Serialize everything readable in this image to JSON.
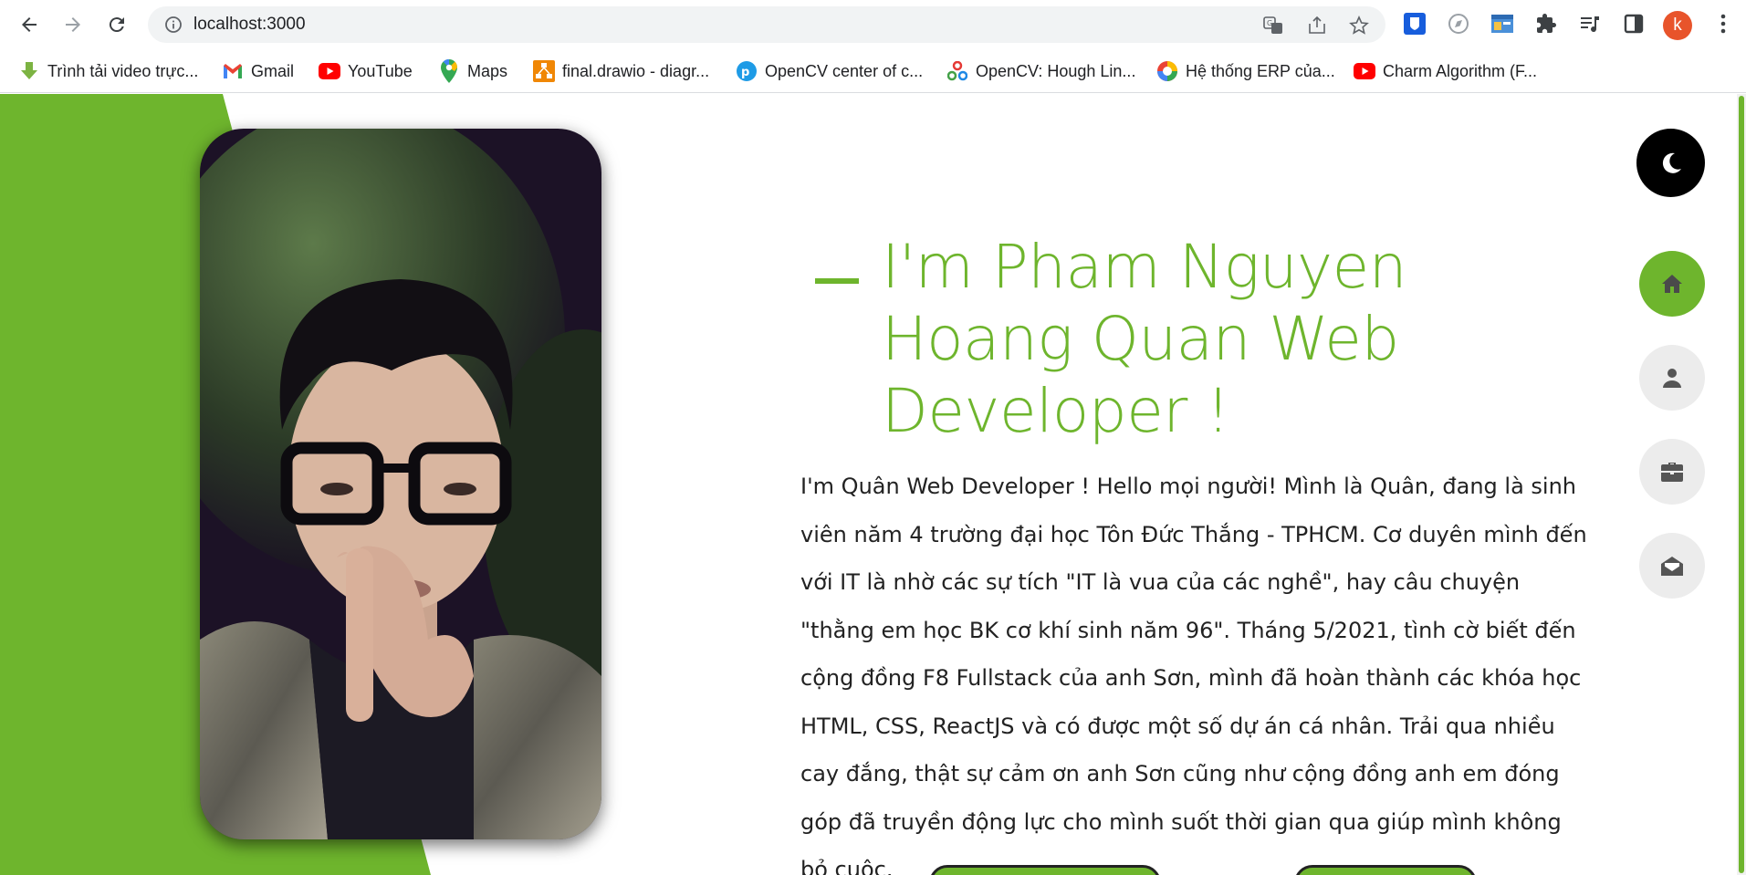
{
  "browser": {
    "url": "localhost:3000",
    "profile_initial": "k",
    "bookmarks": [
      {
        "label": "Trình tải video trực...",
        "icon": "download-arrow-icon",
        "color": "#7cb342"
      },
      {
        "label": "Gmail",
        "icon": "gmail-icon",
        "color": "#ea4335"
      },
      {
        "label": "YouTube",
        "icon": "youtube-icon",
        "color": "#ff0000"
      },
      {
        "label": "Maps",
        "icon": "maps-pin-icon",
        "color": "#34a853"
      },
      {
        "label": "final.drawio - diagr...",
        "icon": "drawio-icon",
        "color": "#f08705"
      },
      {
        "label": "OpenCV center of c...",
        "icon": "pyimagesearch-icon",
        "color": "#1e9be6"
      },
      {
        "label": "OpenCV: Hough Lin...",
        "icon": "opencv-icon",
        "color": "#5c6bc0"
      },
      {
        "label": "Hệ thống ERP của...",
        "icon": "erp-icon",
        "color": "#4285f4"
      },
      {
        "label": "Charm Algorithm (F...",
        "icon": "youtube-icon",
        "color": "#ff0000"
      }
    ]
  },
  "hero": {
    "headline": "I'm Pham Nguyen Hoang Quan Web Developer !",
    "bio": "I'm Quân Web Developer ! Hello mọi người! Mình là Quân, đang là sinh viên năm 4 trường đại học Tôn Đức Thắng - TPHCM. Cơ duyên mình đến với IT là nhờ các sự tích \"IT là vua của các nghề\", hay câu chuyện \"thằng em học BK cơ khí sinh năm 96\". Tháng 5/2021, tình cờ biết đến cộng đồng F8 Fullstack của anh Sơn, mình đã hoàn thành các khóa học HTML, CSS, ReactJS và có được một số dự án cá nhân. Trải qua nhiều cay đắng, thật sự cảm ơn anh Sơn cũng như cộng đồng anh em đóng góp đã truyền động lực cho mình suốt thời gian qua giúp mình không bỏ cuộc."
  },
  "sidenav": [
    {
      "name": "home",
      "icon": "home-icon",
      "active": true
    },
    {
      "name": "about",
      "icon": "user-icon",
      "active": false
    },
    {
      "name": "portfolio",
      "icon": "briefcase-icon",
      "active": false
    },
    {
      "name": "contact",
      "icon": "envelope-open-icon",
      "active": false
    }
  ],
  "theme_toggle": {
    "icon": "moon-icon"
  },
  "colors": {
    "accent": "#6eb52d",
    "dark": "#000000",
    "side_bg": "#ececec",
    "profile": "#e8542b"
  }
}
